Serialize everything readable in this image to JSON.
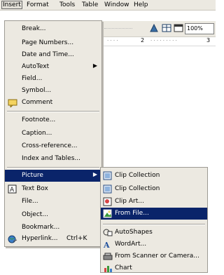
{
  "menubar": {
    "items": [
      "Insert",
      "Format",
      "Tools",
      "Table",
      "Window",
      "Help"
    ]
  },
  "toolbar": {
    "zoom": "100%"
  },
  "ruler": {
    "numbers": [
      "2",
      "3"
    ]
  },
  "insert_menu": {
    "items": [
      {
        "label": "Break..."
      },
      {
        "label": "Page Numbers..."
      },
      {
        "label": "Date and Time..."
      },
      {
        "label": "AutoText"
      },
      {
        "label": "Field..."
      },
      {
        "label": "Symbol..."
      },
      {
        "label": "Comment"
      },
      {
        "label": "Footnote..."
      },
      {
        "label": "Caption..."
      },
      {
        "label": "Cross-reference..."
      },
      {
        "label": "Index and Tables..."
      },
      {
        "label": "Picture"
      },
      {
        "label": "Text Box"
      },
      {
        "label": "File..."
      },
      {
        "label": "Object..."
      },
      {
        "label": "Bookmark..."
      },
      {
        "label": "Hyperlink...",
        "shortcut": "Ctrl+K"
      }
    ]
  },
  "picture_submenu": {
    "items": [
      {
        "label": "Clip Collection"
      },
      {
        "label": "Clip Collection"
      },
      {
        "label": "Clip Art..."
      },
      {
        "label": "From File..."
      },
      {
        "label": "AutoShapes"
      },
      {
        "label": "WordArt..."
      },
      {
        "label": "From Scanner or Camera..."
      },
      {
        "label": "Chart"
      }
    ]
  }
}
